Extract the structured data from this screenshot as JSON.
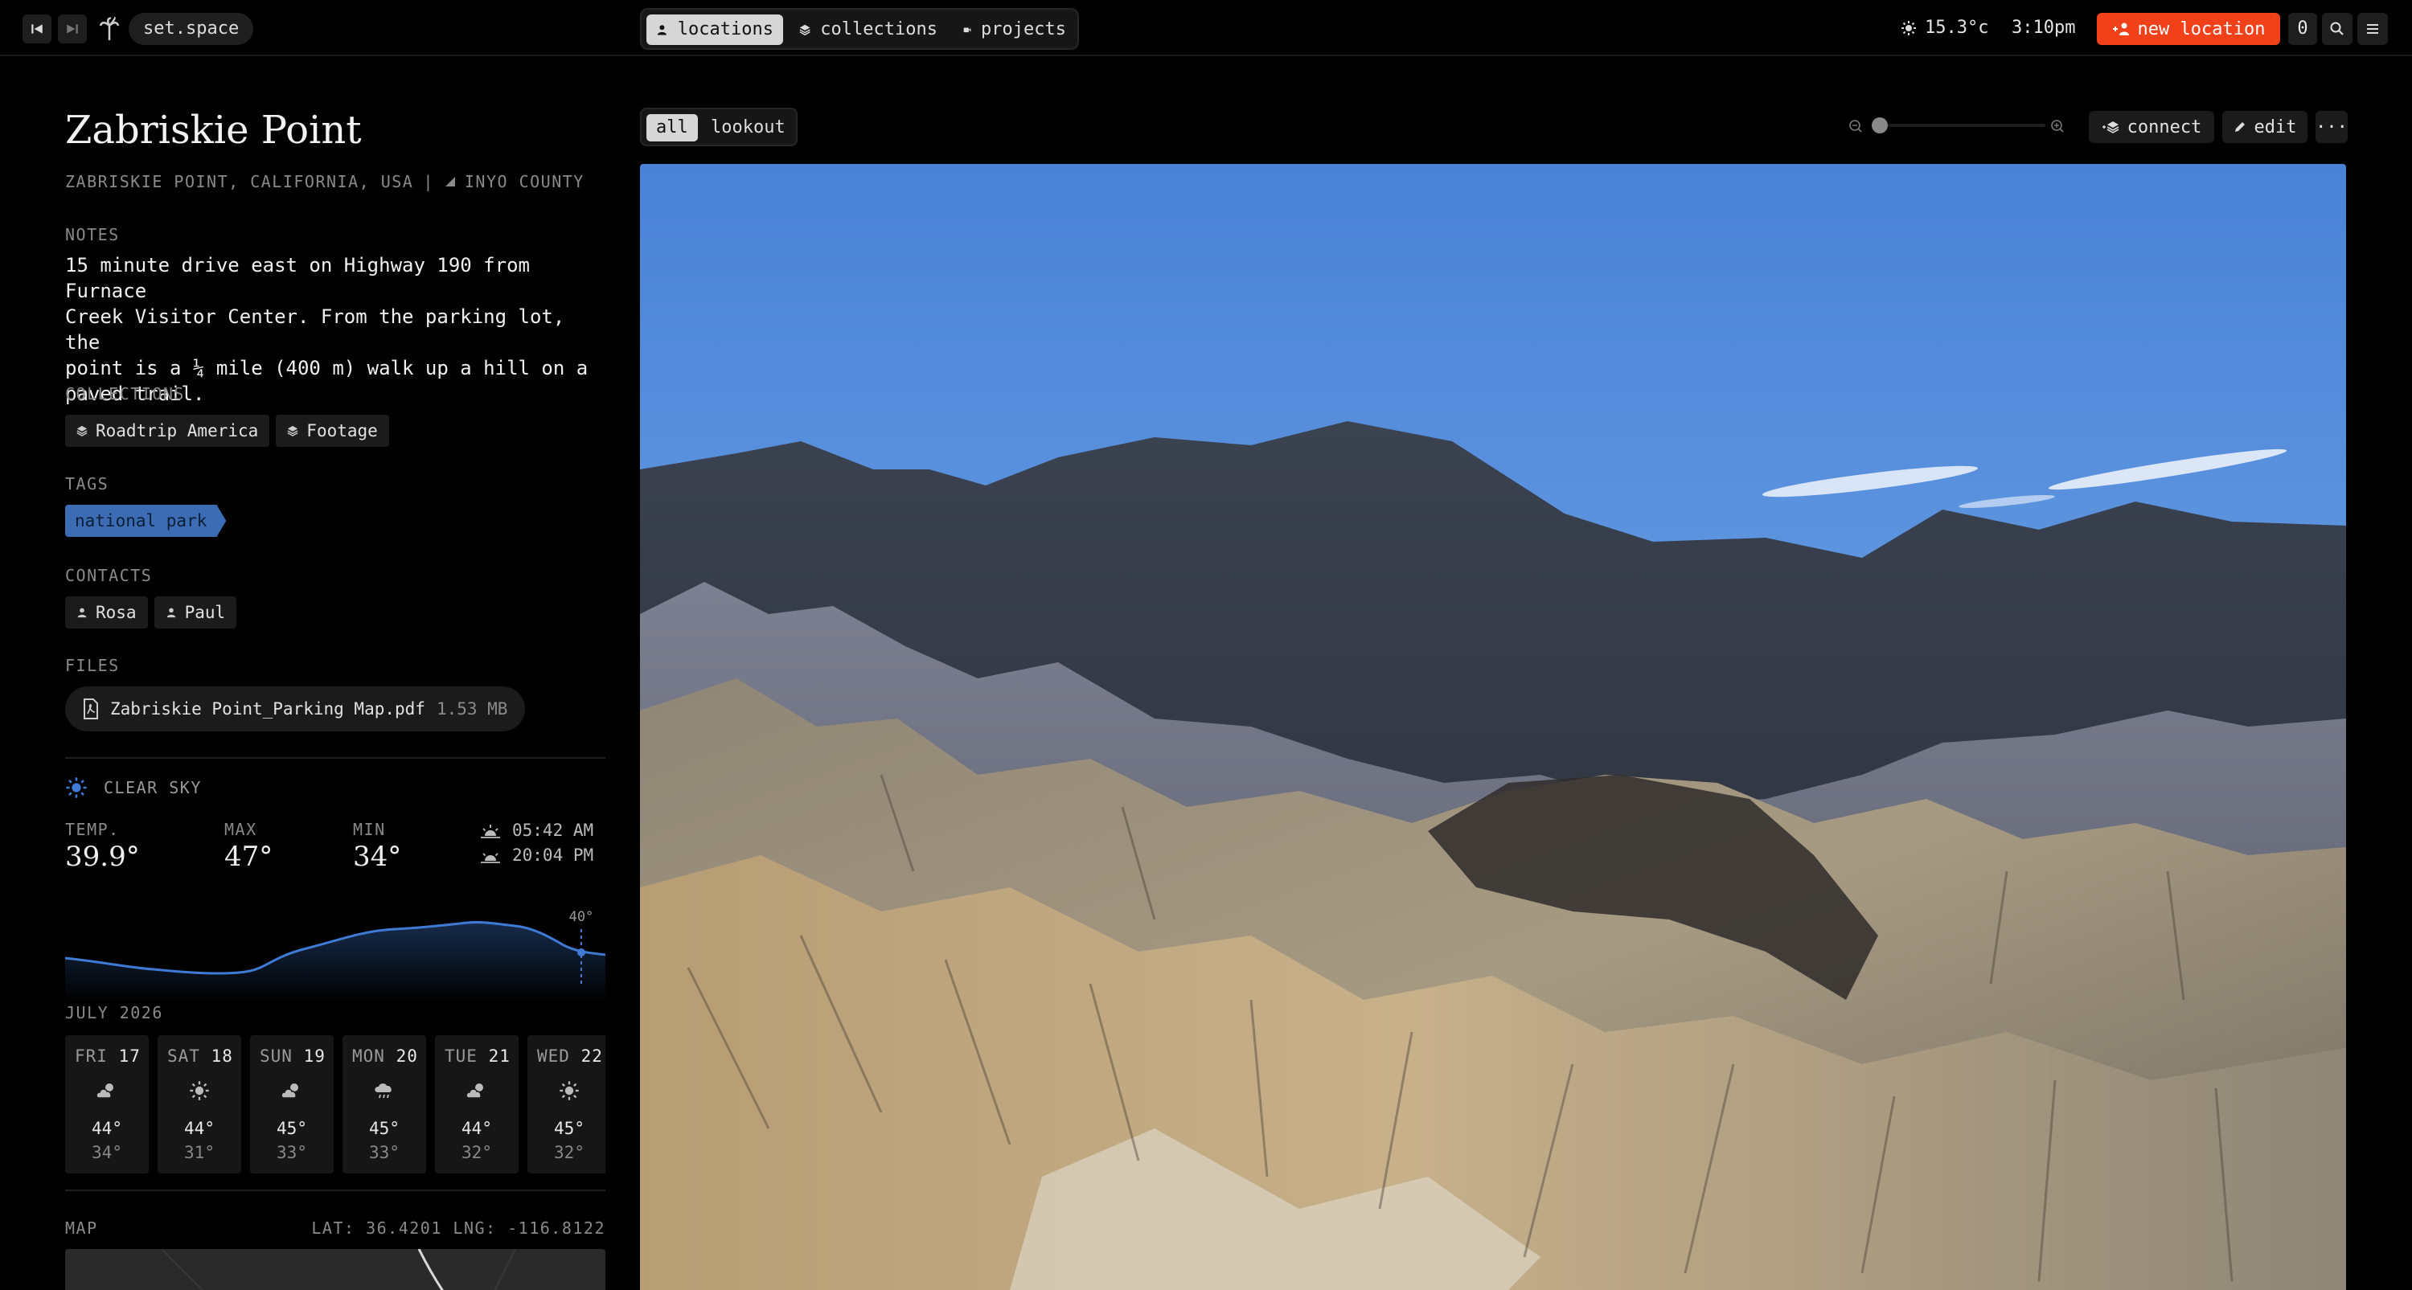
{
  "topbar": {
    "app_name": "set.space",
    "nav": [
      {
        "label": "locations",
        "icon": "person-pin-icon",
        "active": true
      },
      {
        "label": "collections",
        "icon": "layers-icon",
        "active": false
      },
      {
        "label": "projects",
        "icon": "camera-icon",
        "active": false
      }
    ],
    "temperature": "15.3°c",
    "time": "3:10pm",
    "new_location_label": "new location",
    "count": "0"
  },
  "location": {
    "title": "Zabriskie Point",
    "address": "ZABRISKIE POINT, CALIFORNIA, USA",
    "separator": "|",
    "county": "INYO COUNTY",
    "notes_label": "NOTES",
    "notes": "15 minute drive east on Highway 190 from Furnace\nCreek Visitor Center. From the parking lot, the\npoint is a ¼ mile (400 m) walk up a hill on a\npaved trail.",
    "collections_label": "COLLECTIONS",
    "collections": [
      "Roadtrip America",
      "Footage"
    ],
    "tags_label": "TAGS",
    "tags": [
      "national park"
    ],
    "contacts_label": "CONTACTS",
    "contacts": [
      "Rosa",
      "Paul"
    ],
    "files_label": "FILES",
    "files": [
      {
        "name": "Zabriskie Point_Parking Map.pdf",
        "size": "1.53 MB"
      }
    ]
  },
  "weather": {
    "condition": "CLEAR SKY",
    "temp_label": "TEMP.",
    "temp": "39.9°",
    "max_label": "MAX",
    "max": "47°",
    "min_label": "MIN",
    "min": "34°",
    "sunrise": "05:42 AM",
    "sunset": "20:04 PM",
    "graph_marker": "40°",
    "month": "JULY 2026",
    "days": [
      {
        "dow": "FRI",
        "date": "17",
        "icon": "cloud-sun-icon",
        "hi": "44°",
        "lo": "34°"
      },
      {
        "dow": "SAT",
        "date": "18",
        "icon": "sun-icon",
        "hi": "44°",
        "lo": "31°"
      },
      {
        "dow": "SUN",
        "date": "19",
        "icon": "cloud-sun-icon",
        "hi": "45°",
        "lo": "33°"
      },
      {
        "dow": "MON",
        "date": "20",
        "icon": "cloud-rain-icon",
        "hi": "45°",
        "lo": "33°"
      },
      {
        "dow": "TUE",
        "date": "21",
        "icon": "cloud-sun-icon",
        "hi": "44°",
        "lo": "32°"
      },
      {
        "dow": "WED",
        "date": "22",
        "icon": "sun-icon",
        "hi": "45°",
        "lo": "32°"
      }
    ]
  },
  "map": {
    "label": "MAP",
    "coords": "LAT: 36.4201 LNG: -116.8122"
  },
  "gallery": {
    "filters": [
      {
        "label": "all",
        "active": true
      },
      {
        "label": "lookout",
        "active": false
      }
    ],
    "connect_label": "connect",
    "edit_label": "edit",
    "more_label": "···",
    "zoom_level": 0
  },
  "colors": {
    "accent": "#f0411a",
    "tag": "#3c6db4",
    "graph_line": "#3f7bd6"
  }
}
